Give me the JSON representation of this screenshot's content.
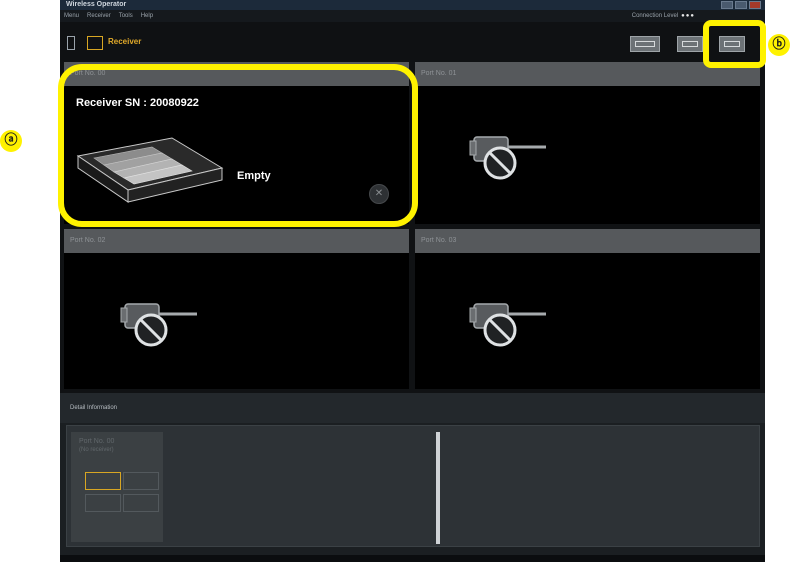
{
  "window": {
    "title": "Wireless Operator",
    "menu": [
      "Menu",
      "Receiver",
      "Tools",
      "Help"
    ],
    "connection_label": "Connection Level",
    "connection_dots": "●●●"
  },
  "toolbar": {
    "title": "Receiver"
  },
  "panels": [
    {
      "header": "Port No. 00",
      "receiver_sn": "Receiver SN : 20080922",
      "state": "Empty",
      "close_symbol": "✕"
    },
    {
      "header": "Port No. 01"
    },
    {
      "header": "Port No. 02"
    },
    {
      "header": "Port No. 03"
    }
  ],
  "status": {
    "title": "Detail Information",
    "port_label": "Port No. 00",
    "state_label": "(No receiver)"
  },
  "callouts": {
    "a": "ⓐ",
    "b": "ⓑ"
  },
  "colors": {
    "highlight": "#fff200",
    "accent": "#e0a92a",
    "panel_header": "#56595c"
  },
  "icons": {
    "camera_disconnected": "camera-disconnected-icon",
    "receiver_tray": "receiver-tray-icon"
  }
}
